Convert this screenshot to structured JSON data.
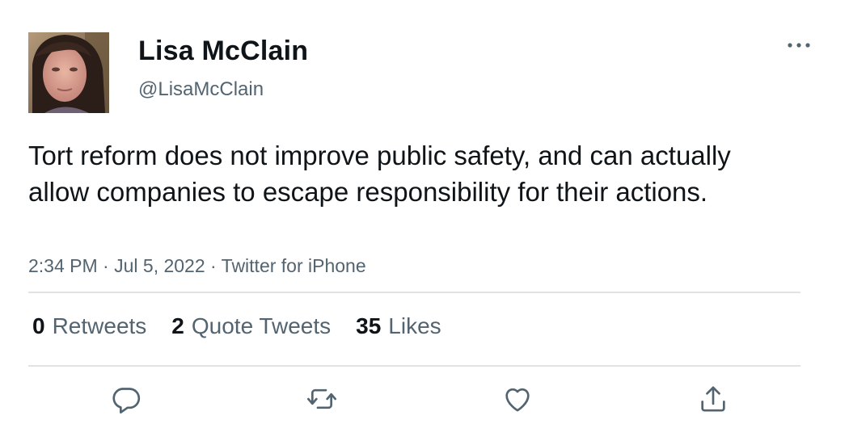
{
  "author": {
    "display_name": "Lisa McClain",
    "handle": "@LisaMcClain"
  },
  "tweet": {
    "text": "Tort reform does not improve public safety, and can actually allow companies to escape responsibility for their actions.",
    "time": "2:34 PM",
    "date": "Jul 5, 2022",
    "source": "Twitter for iPhone",
    "separator": " · "
  },
  "stats": {
    "retweets_count": "0",
    "retweets_label": "Retweets",
    "quote_tweets_count": "2",
    "quote_tweets_label": "Quote Tweets",
    "likes_count": "35",
    "likes_label": "Likes"
  },
  "icons": {
    "more": "more-horizontal-icon",
    "reply": "reply-icon",
    "retweet": "retweet-icon",
    "like": "heart-icon",
    "share": "share-icon"
  },
  "colors": {
    "text_primary": "#0f1419",
    "text_secondary": "#536471",
    "divider": "#dfe3e6"
  }
}
